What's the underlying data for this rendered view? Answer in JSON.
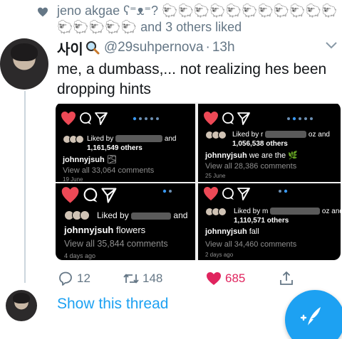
{
  "liked_line": {
    "names": "jeno akgae ʕ⁼ᴥ⁼?",
    "emoji": "🐑🐑🐑🐑🐑🐑🐑🐑🐑🐑🐑🐑🐑🐑🐑🐑",
    "suffix": "and 3 others liked"
  },
  "tweet": {
    "author_name": "사이",
    "author_emoji": "magnifier-emoji",
    "handle": "@29suhpernova",
    "separator": "·",
    "time": "13h",
    "text": "me, a dumbass,... not realizing hes been dropping hints"
  },
  "panels": [
    {
      "liked_by": "Liked by",
      "tail": "and",
      "count": "1,161,549 others",
      "username": "johnnyjsuh",
      "caption": "🌫",
      "view_all": "View all 33,064 comments",
      "date": "19 June"
    },
    {
      "liked_by": "Liked by r",
      "tail": "oz and",
      "count": "1,056,538 others",
      "username": "johnnyjsuh",
      "caption": "we are the 🌿",
      "view_all": "View all 28,386 comments",
      "date": "25 June"
    },
    {
      "liked_by": "Liked by",
      "tail": "and",
      "count": "",
      "username": "johnnyjsuh",
      "caption": "flowers",
      "view_all": "View all 35,844 comments",
      "date": "4 days ago"
    },
    {
      "liked_by": "Liked by m",
      "tail": "oz and",
      "count": "1,110,571 others",
      "username": "johnnyjsuh",
      "caption": "fall",
      "view_all": "View all 34,460 comments",
      "date": "2 days ago"
    }
  ],
  "actions": {
    "reply_count": "12",
    "retweet_count": "148",
    "like_count": "685"
  },
  "show_thread": "Show this thread",
  "colors": {
    "accent": "#1da1f2",
    "like": "#e0245e",
    "muted": "#657786",
    "instagram_red": "#ed4956"
  }
}
